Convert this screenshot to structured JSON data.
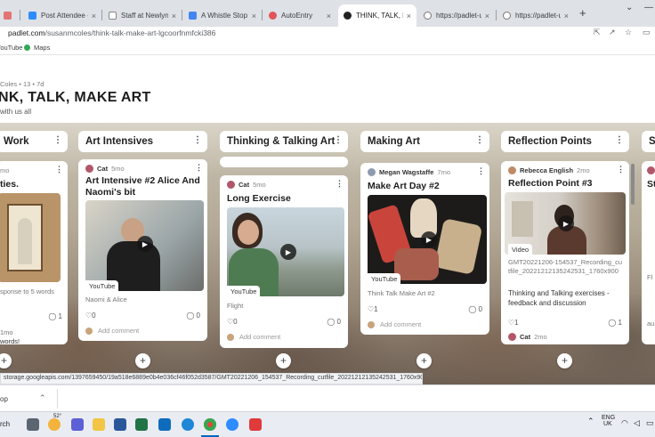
{
  "browser": {
    "tabs": [
      {
        "title": "Post Attendee - Z",
        "color": "#2d8cff",
        "active": false
      },
      {
        "title": "Staff at Newlyn A",
        "color": "#888888",
        "active": false
      },
      {
        "title": "A Whistle Stop To",
        "color": "#4285f4",
        "active": false
      },
      {
        "title": "AutoEntry",
        "color": "#e0555a",
        "active": false
      },
      {
        "title": "THINK, TALK, MAK",
        "color": "#222222",
        "active": true
      },
      {
        "title": "https://padlet-up",
        "color": "#777777",
        "active": false
      },
      {
        "title": "https://padlet-up",
        "color": "#777777",
        "active": false
      }
    ],
    "url_host": "padlet.com",
    "url_path": "/susanmcoles/think-talk-make-art-lgcoorfnmfcki386",
    "bookmarks": [
      "YouTube",
      "Maps"
    ]
  },
  "padlet": {
    "meta": "Coles • 13 • 7d",
    "title": "NK, TALK, MAKE ART",
    "subtitle": "with us all"
  },
  "columns": [
    {
      "label": "Work"
    },
    {
      "label": "Art Intensives"
    },
    {
      "label": "Thinking & Talking Art"
    },
    {
      "label": "Making Art"
    },
    {
      "label": "Reflection Points"
    },
    {
      "label": "S"
    }
  ],
  "cards": {
    "work": {
      "time": "mo",
      "title": "ties.",
      "subtext": "sponse to 5 words",
      "comments": "1",
      "footer_time": "1mo",
      "footer_text": "words!"
    },
    "art_intensives": {
      "author": "Cat",
      "time": "5mo",
      "title": "Art Intensive #2 Alice And Naomi's bit",
      "source": "YouTube",
      "subtext": "Naomi & Alice",
      "likes": "0",
      "comments": "0",
      "add_comment": "Add comment"
    },
    "thinking": {
      "author": "Cat",
      "time": "5mo",
      "title": "Long Exercise",
      "source": "YouTube",
      "subtext": "Flight",
      "likes": "0",
      "comments": "0",
      "add_comment": "Add comment"
    },
    "making": {
      "author": "Megan Wagstaffe",
      "time": "7mo",
      "title": "Make Art Day #2",
      "source": "YouTube",
      "subtext": "Think Talk Make Art #2",
      "likes": "1",
      "comments": "0",
      "add_comment": "Add comment"
    },
    "reflection": {
      "author": "Rebecca English",
      "time": "2mo",
      "title": "Reflection Point #3",
      "source": "Video",
      "file": "GMT20221206-154537_Recording_cutfile_20221212135242531_1760x900",
      "body": "Thinking and Talking exercises - feedback and discussion",
      "likes": "1",
      "comments": "1",
      "next_author": "Cat",
      "next_time": "2mo"
    },
    "partial": {
      "title": "St",
      "label_a": "Fl",
      "label_b": "au"
    }
  },
  "status_url": "storage.googleapis.com/1397659450/19a518e6889e0b4e036cf46f052d3587/GMT20221206_154537_Recording_cutfile_20221212135242531_1760x900.mp4",
  "download_label": "op",
  "taskbar": {
    "search": "rch",
    "weather": "52°",
    "lang_a": "ENG",
    "lang_b": "UK"
  },
  "icons": {
    "play": "play-icon",
    "heart": "heart-icon",
    "comment": "comment-icon"
  }
}
